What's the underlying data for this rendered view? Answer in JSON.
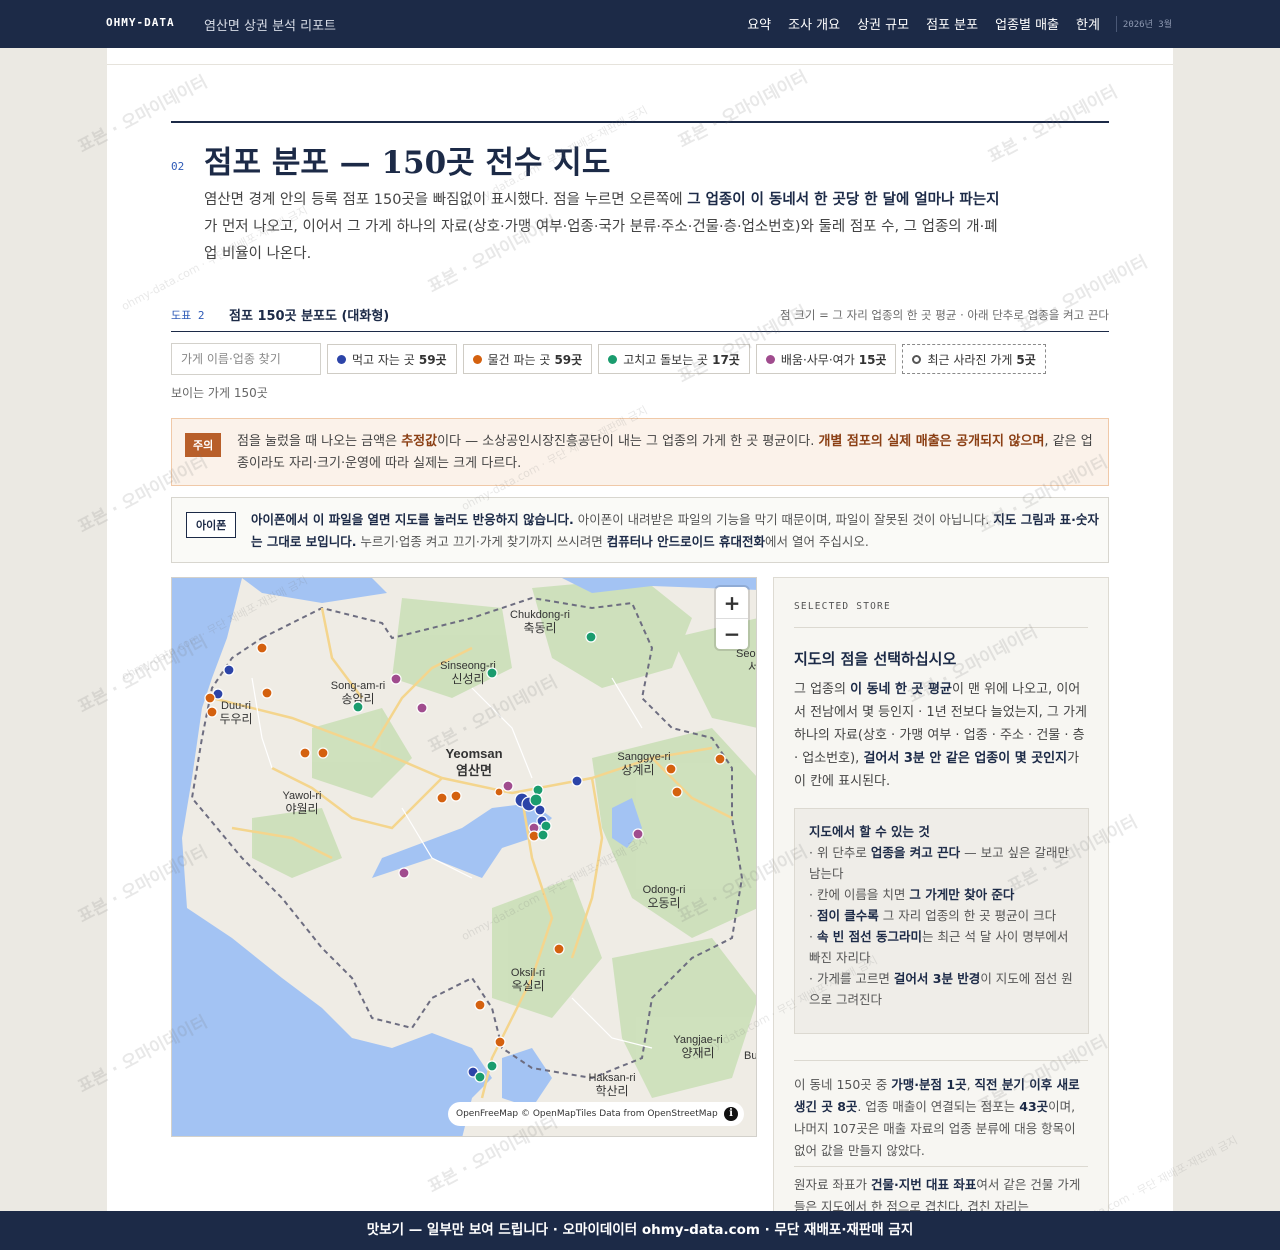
{
  "header": {
    "brand": "OHMY-DATA",
    "report_title": "염산면 상권 분석 리포트",
    "nav": [
      "요약",
      "조사 개요",
      "상권 규모",
      "점포 분포",
      "업종별 매출",
      "한계"
    ],
    "date": "2026년 3월"
  },
  "section": {
    "number": "02",
    "title": "점포 분포 — 150곳 전수 지도",
    "intro_1": "염산면 경계 안의 등록 점포 150곳을 빠짐없이 표시했다. 점을 누르면 오른쪽에 ",
    "intro_b1": "그 업종이 이 동네서 한 곳당 한 달에 얼마나 파는지",
    "intro_2": "가 먼저 나오고, 이어서 그 가게 하나의 자료(상호·가맹 여부·업종·국가 분류·주소·건물·층·업소번호)와 둘레 점포 수, 그 업종의 개·폐업 비율이 나온다."
  },
  "figure": {
    "number": "도표 2",
    "title": "점포 150곳 분포도 (대화형)",
    "note": "점 크기 = 그 자리 업종의 한 곳 평균 · 아래 단추로 업종을 켜고 끈다"
  },
  "filters": {
    "search_placeholder": "가게 이름·업종 찾기",
    "chips": [
      {
        "label": "먹고 자는 곳",
        "count": "59곳",
        "color": "#2c44a8"
      },
      {
        "label": "물건 파는 곳",
        "count": "59곳",
        "color": "#d4610f"
      },
      {
        "label": "고치고 돌보는 곳",
        "count": "17곳",
        "color": "#1a9c6e"
      },
      {
        "label": "배움·사무·여가",
        "count": "15곳",
        "color": "#a04c8e"
      },
      {
        "label": "최근 사라진 가게",
        "count": "5곳",
        "color": "#555555"
      }
    ],
    "visible_count": "보이는 가게 150곳"
  },
  "caution": {
    "tag": "주의",
    "t1": "점을 눌렀을 때 나오는 금액은 ",
    "b1": "추정값",
    "t2": "이다 — 소상공인시장진흥공단이 내는 그 업종의 가게 한 곳 평균이다. ",
    "b2": "개별 점포의 실제 매출은 공개되지 않으며",
    "t3": ", 같은 업종이라도 자리·크기·운영에 따라 실제는 크게 다르다."
  },
  "iphone": {
    "tag": "아이폰",
    "b1": "아이폰에서 이 파일을 열면 지도를 눌러도 반응하지 않습니다.",
    "t1": " 아이폰이 내려받은 파일의 기능을 막기 때문이며, 파일이 잘못된 것이 아닙니다. ",
    "b2": "지도 그림과 표·숫자는 그대로 보입니다.",
    "t2": " 누르기·업종 켜고 끄기·가게 찾기까지 쓰시려면 ",
    "b3": "컴퓨터나 안드로이드 휴대전화",
    "t3": "에서 열어 주십시오."
  },
  "map": {
    "places": [
      {
        "en": "Chukdong-ri",
        "ko": "축동리"
      },
      {
        "en": "Sinseong-ri",
        "ko": "신성리"
      },
      {
        "en": "Song-am-ri",
        "ko": "송암리"
      },
      {
        "en": "Duu-ri",
        "ko": "두우리"
      },
      {
        "en": "Yeomsan",
        "ko": "염산면"
      },
      {
        "en": "Sanggye-ri",
        "ko": "상계리"
      },
      {
        "en": "Yawol-ri",
        "ko": "야월리"
      },
      {
        "en": "Odong-ri",
        "ko": "오동리"
      },
      {
        "en": "Oksil-ri",
        "ko": "옥실리"
      },
      {
        "en": "Yangjae-ri",
        "ko": "양재리"
      },
      {
        "en": "Haksan-ri",
        "ko": "학산리"
      },
      {
        "en": "Seo",
        "ko": "서"
      },
      {
        "en": "Bu",
        "ko": ""
      }
    ],
    "zoom_in": "+",
    "zoom_out": "−",
    "attribution": "OpenFreeMap © OpenMapTiles Data from OpenStreetMap",
    "info": "i"
  },
  "side": {
    "label": "SELECTED STORE",
    "title": "지도의 점을 선택하십시오",
    "d1": "그 업종의 ",
    "db1": "이 동네 한 곳 평균",
    "d2": "이 맨 위에 나오고, 이어서 전남에서 몇 등인지 · 1년 전보다 늘었는지, 그 가게 하나의 자료(상호 · 가맹 여부 · 업종 · 주소 · 건물 · 층 · 업소번호), ",
    "db2": "걸어서 3분 안 같은 업종이 몇 곳인지",
    "d3": "가 이 칸에 표시된다.",
    "howto_title": "지도에서 할 수 있는 것",
    "howto": [
      {
        "a": "· 위 단추로 ",
        "b": "업종을 켜고 끈다",
        "c": " — 보고 싶은 갈래만 남는다"
      },
      {
        "a": "· 칸에 이름을 치면 ",
        "b": "그 가게만 찾아 준다",
        "c": ""
      },
      {
        "a": "· ",
        "b": "점이 클수록",
        "c": " 그 자리 업종의 한 곳 평균이 크다"
      },
      {
        "a": "· ",
        "b": "속 빈 점선 동그라미",
        "c": "는 최근 석 달 사이 명부에서 빠진 자리다"
      },
      {
        "a": "· 가게를 고르면 ",
        "b": "걸어서 3분 반경",
        "c": "이 지도에 점선 원으로 그려진다"
      }
    ],
    "s1": "이 동네 150곳 중 ",
    "sb1": "가맹·분점 1곳",
    "s2": ", ",
    "sb2": "직전 분기 이후 새로 생긴 곳 8곳",
    "s3": ". 업종 매출이 연결되는 점포는 ",
    "sb3": "43곳",
    "s4": "이며, 나머지 107곳은 매출 자료의 업종 분류에 대응 항목이 없어 값을 만들지 않았다.",
    "r1": "원자료 좌표가 ",
    "rb1": "건물·지번 대표 좌표",
    "r2": "여서 같은 건물 가게들은 지도에서 한 점으로 겹친다. 겹친 자리는"
  },
  "footer": "맛보기 — 일부만 보여 드립니다 · 오마이데이터 ohmy-data.com · 무단 재배포·재판매 금지",
  "watermark": {
    "big": "표본 · 오마이데이터",
    "small": "ohmy-data.com · 무단 재배포·재판매 금지"
  }
}
